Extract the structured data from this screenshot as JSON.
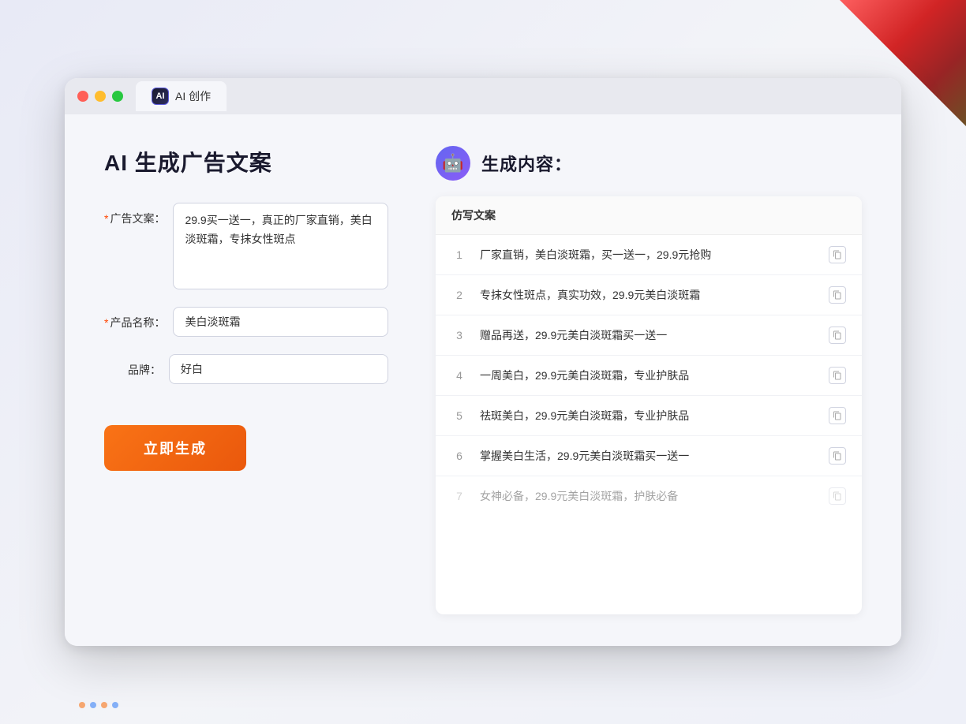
{
  "browser": {
    "tab_label": "AI 创作",
    "tab_icon_text": "AI"
  },
  "left_panel": {
    "page_title": "AI 生成广告文案",
    "form": {
      "ad_copy_label": "广告文案：",
      "ad_copy_required": "*",
      "ad_copy_value": "29.9买一送一，真正的厂家直销，美白淡斑霜，专抹女性斑点",
      "product_name_label": "产品名称：",
      "product_name_required": "*",
      "product_name_value": "美白淡斑霜",
      "brand_label": "品牌：",
      "brand_value": "好白"
    },
    "generate_button": "立即生成"
  },
  "right_panel": {
    "section_title": "生成内容：",
    "table_header": "仿写文案",
    "results": [
      {
        "num": "1",
        "text": "厂家直销，美白淡斑霜，买一送一，29.9元抢购",
        "faded": false
      },
      {
        "num": "2",
        "text": "专抹女性斑点，真实功效，29.9元美白淡斑霜",
        "faded": false
      },
      {
        "num": "3",
        "text": "赠品再送，29.9元美白淡斑霜买一送一",
        "faded": false
      },
      {
        "num": "4",
        "text": "一周美白，29.9元美白淡斑霜，专业护肤品",
        "faded": false
      },
      {
        "num": "5",
        "text": "祛斑美白，29.9元美白淡斑霜，专业护肤品",
        "faded": false
      },
      {
        "num": "6",
        "text": "掌握美白生活，29.9元美白淡斑霜买一送一",
        "faded": false
      },
      {
        "num": "7",
        "text": "女神必备，29.9元美白淡斑霜，护肤必备",
        "faded": true
      }
    ]
  },
  "icons": {
    "copy": "copy-icon",
    "robot": "🤖"
  }
}
